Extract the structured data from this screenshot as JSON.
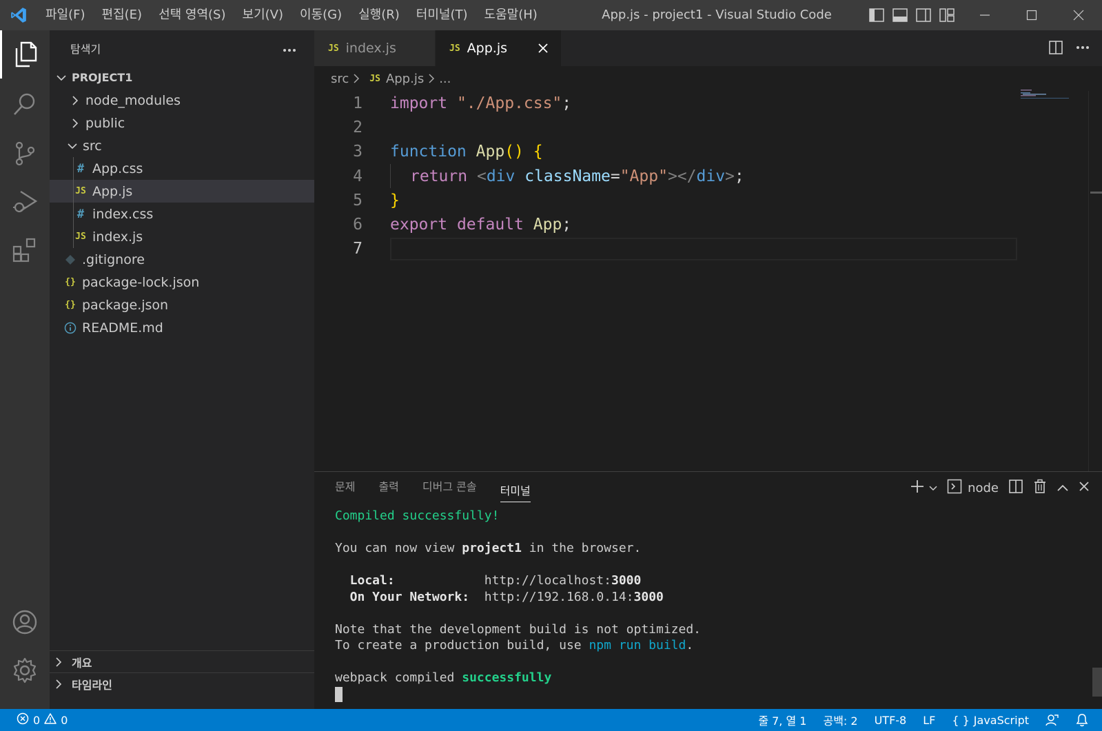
{
  "titlebar": {
    "menu": [
      "파일(F)",
      "편집(E)",
      "선택 영역(S)",
      "보기(V)",
      "이동(G)",
      "실행(R)",
      "터미널(T)",
      "도움말(H)"
    ],
    "window_title": "App.js - project1 - Visual Studio Code"
  },
  "sidebar": {
    "header": "탐색기",
    "project": "PROJECT1",
    "tree": [
      {
        "label": "node_modules",
        "type": "folder",
        "expanded": false
      },
      {
        "label": "public",
        "type": "folder",
        "expanded": false
      },
      {
        "label": "src",
        "type": "folder",
        "expanded": true
      },
      {
        "label": "App.css",
        "type": "css"
      },
      {
        "label": "App.js",
        "type": "js",
        "selected": true
      },
      {
        "label": "index.css",
        "type": "css"
      },
      {
        "label": "index.js",
        "type": "js"
      },
      {
        "label": ".gitignore",
        "type": "git"
      },
      {
        "label": "package-lock.json",
        "type": "json"
      },
      {
        "label": "package.json",
        "type": "json"
      },
      {
        "label": "README.md",
        "type": "info"
      }
    ],
    "icon_labels": {
      "js": "JS",
      "css": "#",
      "json": "{}"
    },
    "outline": "개요",
    "timeline": "타임라인"
  },
  "editor": {
    "tabs": [
      {
        "label": "index.js",
        "active": false
      },
      {
        "label": "App.js",
        "active": true
      }
    ],
    "breadcrumb": {
      "folder": "src",
      "file": "App.js",
      "more": "..."
    },
    "line_numbers": [
      "1",
      "2",
      "3",
      "4",
      "5",
      "6",
      "7"
    ],
    "code": {
      "l1": {
        "kw": "import",
        "str": "\"./App.css\"",
        "end": ";"
      },
      "l3": {
        "kw": "function",
        "fn": "App",
        "paren": "()",
        "brace": "{"
      },
      "l4": {
        "kw": "return",
        "lt": "<",
        "tag": "div",
        "attr": "className",
        "eq": "=",
        "str": "\"App\"",
        "close": "></",
        "tag2": "div",
        "gt": ">",
        "end": ";"
      },
      "l5": {
        "brace": "}"
      },
      "l6": {
        "kw": "export",
        "kw2": "default",
        "name": "App",
        "end": ";"
      }
    }
  },
  "panel": {
    "tabs": [
      "문제",
      "출력",
      "디버그 콘솔",
      "터미널"
    ],
    "active_tab": "터미널",
    "shell": "node",
    "terminal": {
      "compiled": "Compiled successfully!",
      "view_pre": "You can now view ",
      "view_proj": "project1",
      "view_post": " in the browser.",
      "local_label": "  Local:",
      "local_pad": "            ",
      "local_url": "http://localhost:",
      "local_port": "3000",
      "net_label": "  On Your Network:",
      "net_pad": "  ",
      "net_url": "http://192.168.0.14:",
      "net_port": "3000",
      "note1": "Note that the development build is not optimized.",
      "note2_pre": "To create a production build, use ",
      "note2_cmd": "npm run build",
      "note2_post": ".",
      "webpack_pre": "webpack compiled ",
      "webpack_ok": "successfully"
    }
  },
  "statusbar": {
    "errors": "0",
    "warnings": "0",
    "position": "줄 7, 열 1",
    "spaces": "공백: 2",
    "encoding": "UTF-8",
    "eol": "LF",
    "language_icon": "{ }",
    "language": "JavaScript"
  },
  "colors": {
    "statusbar": "#007acc",
    "activitybar": "#333333",
    "sidebar": "#252526",
    "editor": "#1e1e1e",
    "titlebar": "#3c3c3c"
  }
}
